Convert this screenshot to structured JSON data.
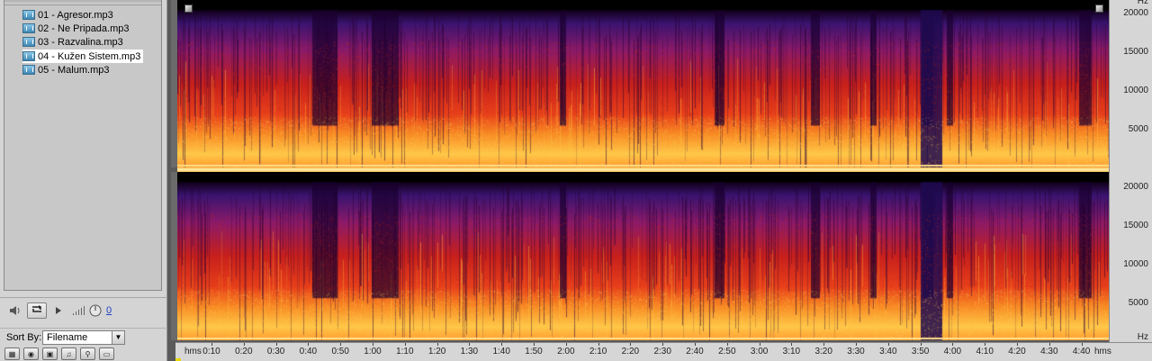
{
  "files": [
    {
      "label": "01 - Agresor.mp3",
      "selected": false
    },
    {
      "label": "02 - Ne Pripada.mp3",
      "selected": false
    },
    {
      "label": "03 - Razvalina.mp3",
      "selected": false
    },
    {
      "label": "04 - Kužen Sistem.mp3",
      "selected": true
    },
    {
      "label": "05 - Malum.mp3",
      "selected": false
    }
  ],
  "panel": {
    "volume_value": "0",
    "sort_label": "Sort By:",
    "sort_value": "Filename"
  },
  "icons": {
    "file": "audio-file-icon",
    "speaker": "speaker-icon",
    "loop": "loop-icon",
    "play": "play-icon",
    "volume_meter": "volume-meter-icon",
    "volume_knob": "volume-knob-icon",
    "dropdown": "chevron-down-icon"
  },
  "hz_ruler": {
    "unit": "Hz",
    "channel_1_ticks": [
      "20000",
      "15000",
      "10000",
      "5000"
    ],
    "channel_2_ticks": [
      "20000",
      "15000",
      "10000",
      "5000"
    ]
  },
  "time_ruler": {
    "unit": "hms",
    "ticks": [
      "0:10",
      "0:20",
      "0:30",
      "0:40",
      "0:50",
      "1:00",
      "1:10",
      "1:20",
      "1:30",
      "1:40",
      "1:50",
      "2:00",
      "2:10",
      "2:20",
      "2:30",
      "2:40",
      "2:50",
      "3:00",
      "3:10",
      "3:20",
      "3:30",
      "3:40",
      "3:50",
      "4:00",
      "4:10",
      "4:20",
      "4:30",
      "4:40"
    ]
  },
  "colors": {
    "spectrum_low": "#000000",
    "spectrum_mid": "#5a1a8c",
    "spectrum_high": "#d8201c",
    "spectrum_peak": "#ffd040",
    "selection_bg": "#ffffff"
  }
}
